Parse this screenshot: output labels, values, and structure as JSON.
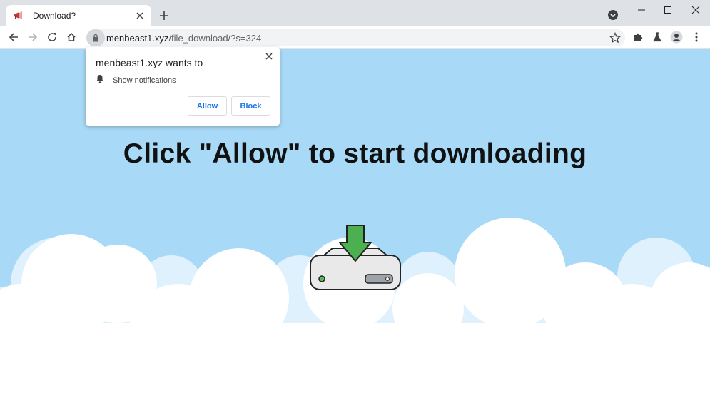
{
  "browser": {
    "tab_title": "Download?",
    "url_domain": "menbeast1.xyz",
    "url_path": "/file_download/?s=324",
    "icons": {
      "favicon": "megaphone-icon",
      "tab_close": "close-icon",
      "new_tab": "plus-icon",
      "tab_search": "tab-search-icon",
      "back": "arrow-left-icon",
      "forward": "arrow-right-icon",
      "reload": "reload-icon",
      "home": "home-icon",
      "lock": "lock-icon",
      "bookmark": "star-icon",
      "extensions": "puzzle-icon",
      "labs": "flask-icon",
      "profile": "avatar-icon",
      "menu": "kebab-menu-icon"
    }
  },
  "popup": {
    "title": "menbeast1.xyz wants to",
    "permission_label": "Show notifications",
    "allow_label": "Allow",
    "block_label": "Block",
    "icons": {
      "close": "close-icon",
      "permission": "bell-icon"
    }
  },
  "page": {
    "headline": "Click \"Allow\" to start downloading",
    "image": "hard-drive-download-icon"
  },
  "colors": {
    "sky": "#a8daf7",
    "cloud": "#ffffff",
    "cloud_back": "#dff1fc",
    "accent_button_text": "#1a73e8",
    "download_arrow": "#4caf50"
  }
}
